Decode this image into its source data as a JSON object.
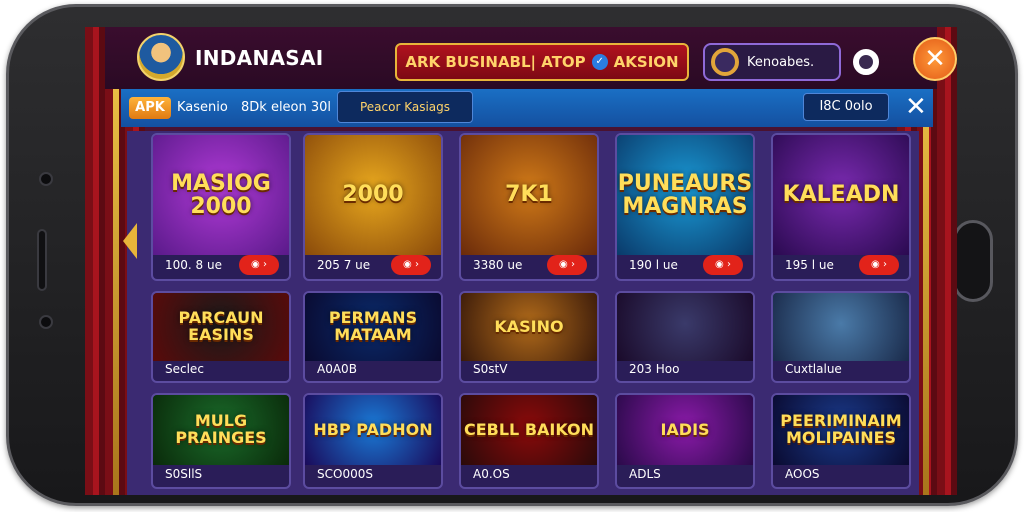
{
  "header": {
    "brand": "INDANASAI",
    "promo": "ARK BUSINABL| ATOP",
    "promo_suffix": "AKSION",
    "user_name": "Kenoabes.",
    "close_symbol": "✕"
  },
  "tabs": {
    "apk_label": "APK",
    "casino_label": "Kasenio",
    "online_count": "8Dk eleon 30l",
    "featured_label": "Peacor Kasiags",
    "online_box": "I8C 0olo",
    "close_symbol": "✕"
  },
  "games": [
    {
      "title": "MASIOG 2000",
      "footer": "100. 8 ue"
    },
    {
      "title": "2000",
      "footer": "205 7 ue"
    },
    {
      "title": "7K1",
      "footer": "3380 ue"
    },
    {
      "title": "PUNEAURS MAGNRAS",
      "footer": "190 l ue"
    },
    {
      "title": "KALEADN",
      "footer": "195 l ue"
    },
    {
      "title": "PARCAUN EASINS",
      "footer": "Seclec"
    },
    {
      "title": "PERMANS MATAAM",
      "footer": "A0A0B"
    },
    {
      "title": "KASINO",
      "footer": "S0stV"
    },
    {
      "title": "",
      "footer": "203 Hoo"
    },
    {
      "title": "",
      "footer": "Cuxtlalue"
    },
    {
      "title": "MULG PRAINGES",
      "footer": "S0SllS"
    },
    {
      "title": "HBP PADHON",
      "footer": "SCO000S"
    },
    {
      "title": "CEBLL BAIKON",
      "footer": "A0.OS"
    },
    {
      "title": "IADIS",
      "footer": "ADLS"
    },
    {
      "title": "PEERIMINAIM MOLIPAINES",
      "footer": "AOOS"
    }
  ],
  "colors": {
    "accent_gold": "#e8b53a",
    "tab_blue": "#1a6fc4",
    "play_red": "#e2231a",
    "close_orange": "#e25a16"
  }
}
